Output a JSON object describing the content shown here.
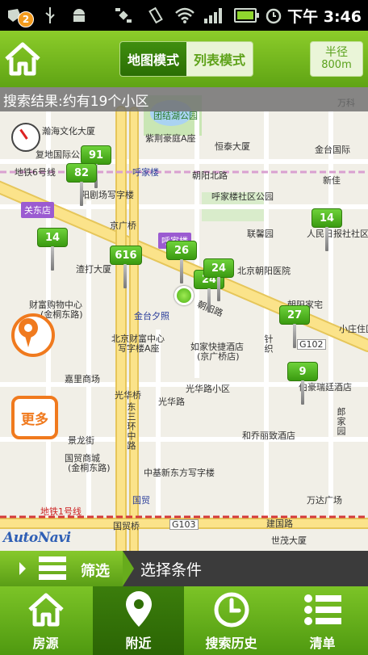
{
  "status_bar": {
    "notification_count": "2",
    "time": "下午 3:46",
    "icons": [
      "app-icon",
      "usb-icon",
      "android-icon",
      "satellite-icon",
      "vibrate-icon",
      "wifi-icon",
      "signal-icon",
      "battery-icon",
      "alarm-icon"
    ]
  },
  "header": {
    "home_icon": "home-icon",
    "mode_tabs": [
      {
        "label": "地图模式",
        "active": true
      },
      {
        "label": "列表模式",
        "active": false
      }
    ],
    "radius": {
      "label": "半径",
      "value": "800m"
    }
  },
  "map": {
    "result_text": "搜索结果:约有19个小区",
    "pins": [
      {
        "count": "91"
      },
      {
        "count": "82"
      },
      {
        "count": "14"
      },
      {
        "count": "616"
      },
      {
        "count": "26"
      },
      {
        "count": "24"
      },
      {
        "count": "24"
      },
      {
        "count": "14"
      },
      {
        "count": "27"
      },
      {
        "count": "9"
      }
    ],
    "labels": {
      "park": "团结湖公园",
      "hanhai": "瀚海文化大厦",
      "fudi": "复地国际公寓",
      "zijing": "紫荆豪庭A座",
      "hengtai": "恒泰大厦",
      "jintai": "金台国际",
      "line6": "地铁6号线",
      "hujialou": "呼家楼",
      "chaoyang_n": "朝阳北路",
      "bldg_a": "阳剧场写字楼",
      "hujialou_area": "呼家楼社区公园",
      "xinjia": "新佳",
      "guandong": "关东店",
      "jingguang": "京广桥",
      "hujialou_tag": "呼家楼",
      "lianxiang": "联馨园",
      "peoples": "人民日报社社区",
      "liaoshi": "渣打大厦",
      "hospital": "北京朝阳医院",
      "chaoyang_rd": "朝阳路",
      "caifu": "财富购物中心",
      "caifu2": "(金桐东路)",
      "jintaixizhao": "金台夕照",
      "chaoyang_home": "朝阳家宅",
      "caifu_center": "北京财富中心",
      "writing_a": "写字楼A座",
      "rujia": "如家快捷酒店",
      "rujia2": "(京广桥店)",
      "xiaozhuang": "小庄住区",
      "g102": "G102",
      "zhenqing": "针织",
      "jiali": "嘉里商场",
      "guanghua_bridge": "光华桥",
      "guanghua_rd": "光华路",
      "guanghua_area": "光华路小区",
      "bohao": "伯豪瑞廷酒店",
      "jingguang_east": "景龙街",
      "dongsan": "东三环中路",
      "guomao_mall": "国贸商城",
      "guomao_mall2": "(金桐东路)",
      "heqiao": "和乔丽致酒店",
      "lang": "郎家园",
      "zhongji": "中基新东方写字楼",
      "guomao": "国贸",
      "wanda": "万达广场",
      "guomaoqiao": "国贸桥",
      "g103": "G103",
      "line1": "地铁1号线",
      "jianguo": "建国路",
      "shiji": "世茂大厦",
      "wanli": "万科"
    },
    "compass_icon": "compass-icon",
    "locate_icon": "locate-icon",
    "more_label": "更多",
    "brand": "AutoNavi"
  },
  "filter": {
    "label": "筛选",
    "condition": "选择条件"
  },
  "bottom_nav": [
    {
      "label": "房源",
      "icon": "house-icon",
      "active": false
    },
    {
      "label": "附近",
      "icon": "location-pin-icon",
      "active": true
    },
    {
      "label": "搜索历史",
      "icon": "clock-icon",
      "active": false
    },
    {
      "label": "清单",
      "icon": "list-icon",
      "active": false
    }
  ],
  "colors": {
    "brand_green": "#6ab61e",
    "active_green": "#2f6e06",
    "accent_orange": "#f07a1e"
  }
}
